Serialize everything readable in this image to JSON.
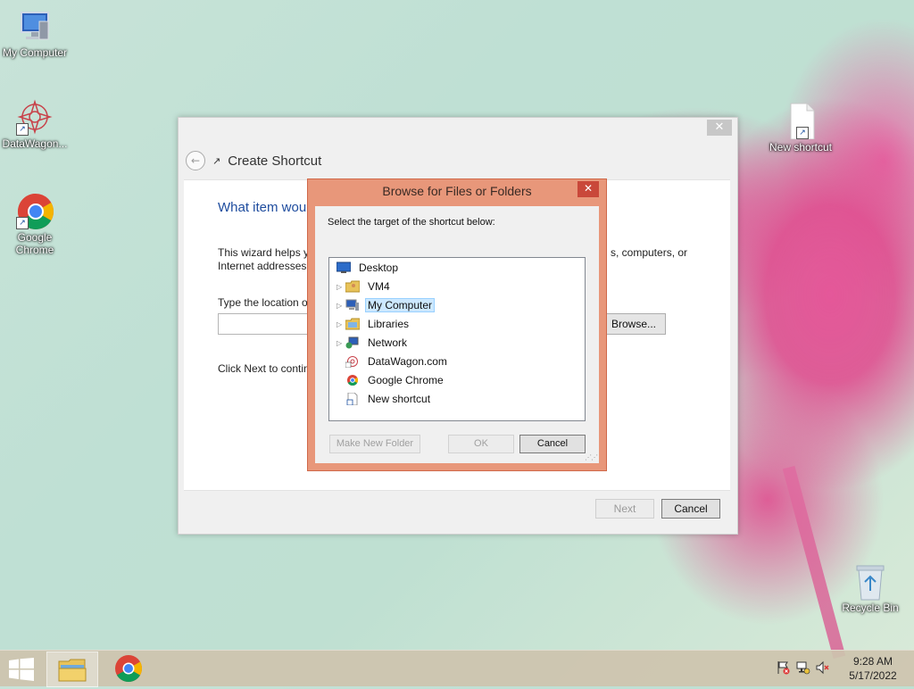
{
  "desktop": {
    "icons": [
      {
        "label": "My Computer"
      },
      {
        "label": "DataWagon..."
      },
      {
        "label": "Google Chrome"
      },
      {
        "label": "New shortcut"
      },
      {
        "label": "Recycle Bin"
      }
    ]
  },
  "wizard": {
    "close_label": "✕",
    "back_label": "←",
    "title": "Create Shortcut",
    "question": "What item wou",
    "help_line1_left": "This wizard helps yo",
    "help_line1_right": "s, computers, or",
    "help_line2": "Internet addresses.",
    "location_label": "Type the location o",
    "location_value": "",
    "browse_label": "Browse...",
    "next_hint": "Click Next to contin",
    "next_label": "Next",
    "cancel_label": "Cancel"
  },
  "browse_dialog": {
    "title": "Browse for Files or Folders",
    "close_label": "✕",
    "instruction": "Select the target of the shortcut below:",
    "tree": [
      {
        "label": "Desktop",
        "expandable": false,
        "icon": "desktop-icon"
      },
      {
        "label": "VM4",
        "expandable": true,
        "icon": "user-folder-icon"
      },
      {
        "label": "My Computer",
        "expandable": true,
        "icon": "computer-icon",
        "selected": true
      },
      {
        "label": "Libraries",
        "expandable": true,
        "icon": "libraries-icon"
      },
      {
        "label": "Network",
        "expandable": true,
        "icon": "network-icon"
      },
      {
        "label": "DataWagon.com",
        "expandable": false,
        "icon": "datawagon-shortcut-icon"
      },
      {
        "label": "Google Chrome",
        "expandable": false,
        "icon": "chrome-shortcut-icon"
      },
      {
        "label": "New shortcut",
        "expandable": false,
        "icon": "shortcut-file-icon"
      }
    ],
    "new_folder_label": "Make New Folder",
    "ok_label": "OK",
    "cancel_label": "Cancel"
  },
  "taskbar": {
    "time": "9:28 AM",
    "date": "5/17/2022"
  },
  "colors": {
    "dialog_frame": "#e8977a",
    "dialog_close": "#c9483a",
    "wizard_heading": "#1e4c9e",
    "selection": "#cce8ff"
  }
}
